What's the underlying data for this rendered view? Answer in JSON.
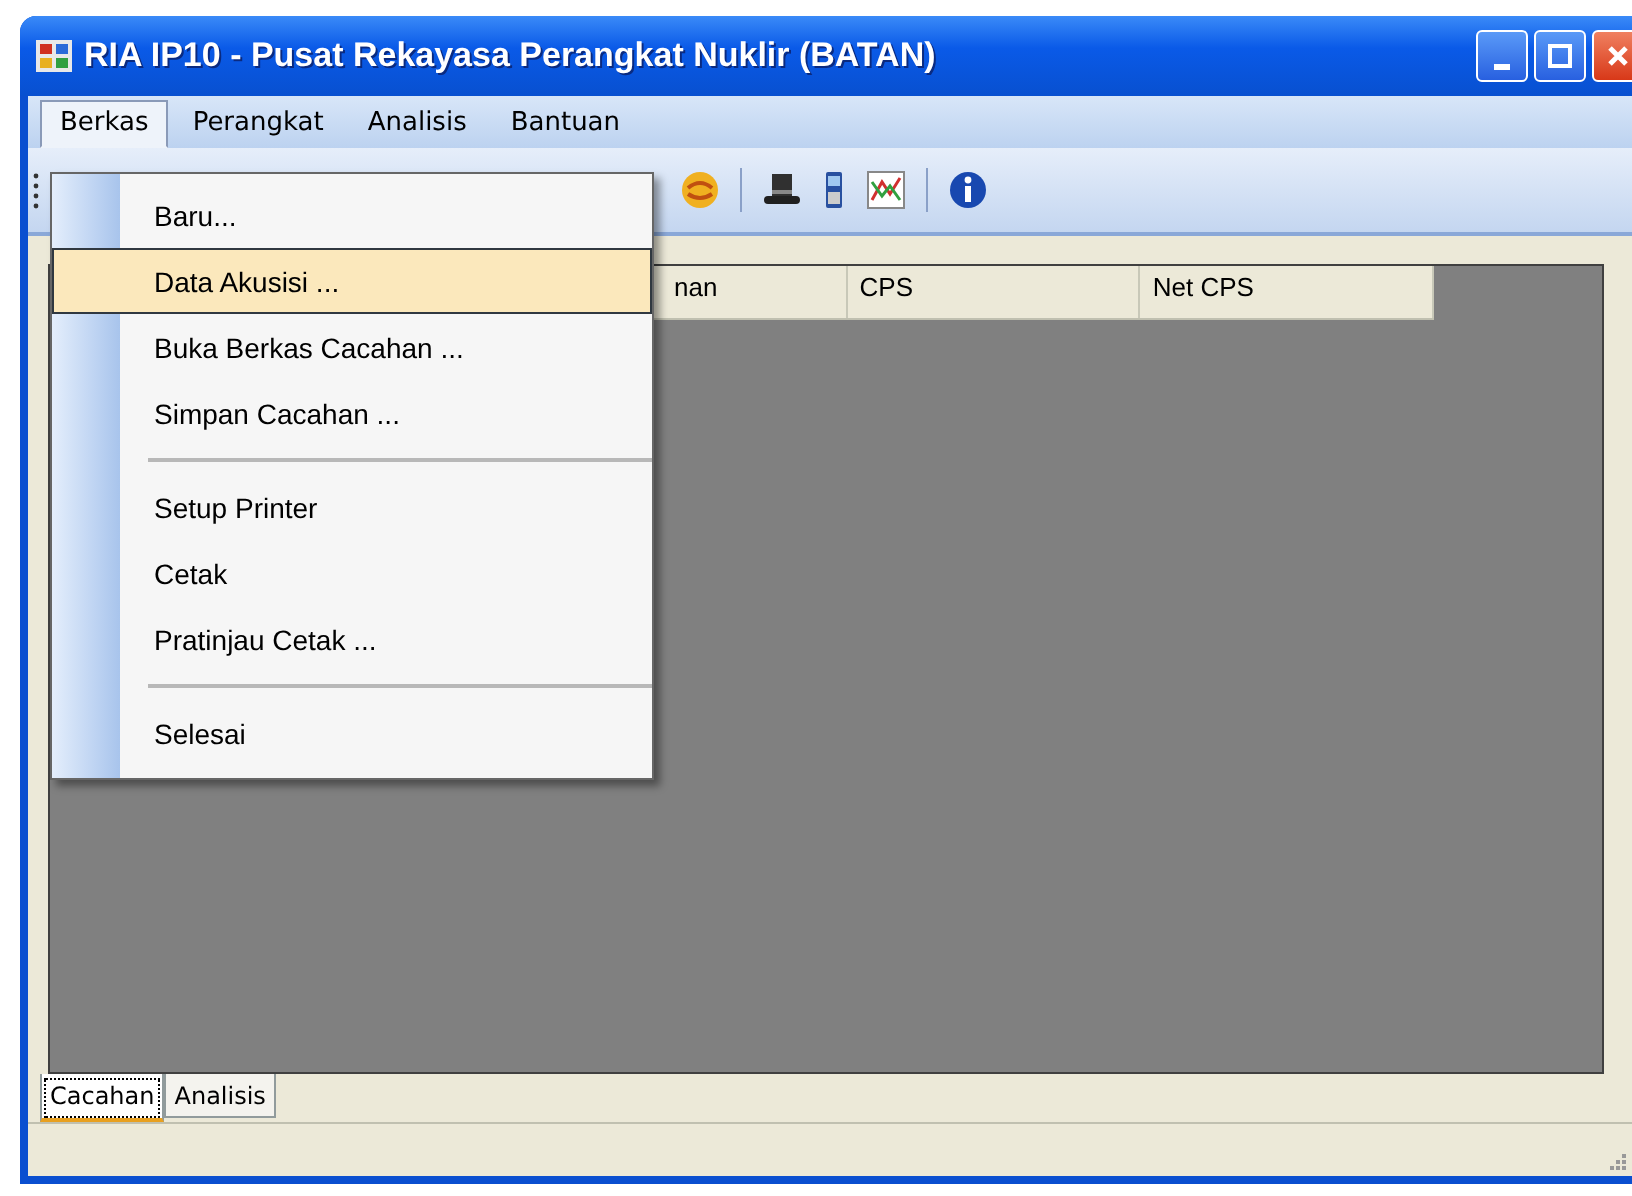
{
  "window": {
    "title": "RIA IP10 - Pusat Rekayasa Perangkat Nuklir (BATAN)"
  },
  "menu_bar": [
    {
      "label": "Berkas",
      "selected": true
    },
    {
      "label": "Perangkat",
      "selected": false
    },
    {
      "label": "Analisis",
      "selected": false
    },
    {
      "label": "Bantuan",
      "selected": false
    }
  ],
  "dropdown_menu": [
    {
      "kind": "item",
      "label": "Baru...",
      "selected": false
    },
    {
      "kind": "item",
      "label": "Data Akusisi ...",
      "selected": true
    },
    {
      "kind": "item",
      "label": "Buka Berkas Cacahan ...",
      "selected": false
    },
    {
      "kind": "item",
      "label": "Simpan Cacahan ...",
      "selected": false
    },
    {
      "kind": "separator"
    },
    {
      "kind": "item",
      "label": "Setup Printer",
      "selected": false
    },
    {
      "kind": "item",
      "label": "Cetak",
      "selected": false
    },
    {
      "kind": "item",
      "label": "Pratinjau Cetak ...",
      "selected": false
    },
    {
      "kind": "separator"
    },
    {
      "kind": "item",
      "label": "Selesai",
      "selected": false
    }
  ],
  "table": {
    "columns": [
      "nan",
      "CPS",
      "Net CPS"
    ]
  },
  "tabs": [
    {
      "label": "Cacahan",
      "selected": true
    },
    {
      "label": "Analisis",
      "selected": false
    }
  ]
}
